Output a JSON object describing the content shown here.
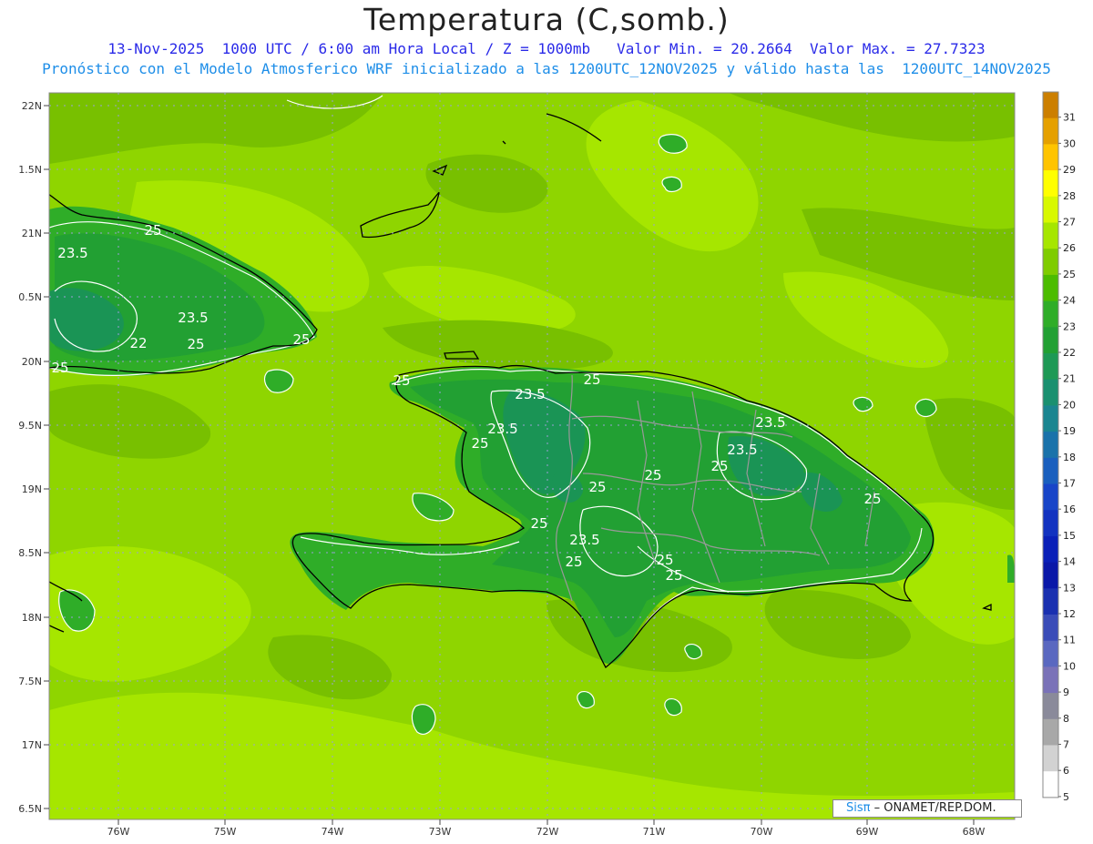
{
  "header": {
    "title": "Temperatura (C,somb.)",
    "line1": "13-Nov-2025  1000 UTC / 6:00 am Hora Local / Z = 1000mb   Valor Min. = 20.2664  Valor Max. = 27.7323",
    "line2": "Pronóstico con el Modelo Atmosferico WRF inicializado a las 1200UTC_12NOV2025 y válido hasta las  1200UTC_14NOV2025"
  },
  "map": {
    "lat_labels": [
      "22N",
      "1.5N",
      "21N",
      "0.5N",
      "20N",
      "9.5N",
      "19N",
      "8.5N",
      "18N",
      "7.5N",
      "17N",
      "6.5N"
    ],
    "lon_labels": [
      "76W",
      "75W",
      "74W",
      "73W",
      "72W",
      "71W",
      "70W",
      "69W",
      "68W"
    ],
    "contour_labels": [
      "25",
      "23.5",
      "23.5",
      "22",
      "25",
      "25",
      "25",
      "25",
      "23.5",
      "25",
      "23.5",
      "25",
      "23.5",
      "23.5",
      "25",
      "25",
      "25",
      "25",
      "25",
      "23.5",
      "25",
      "25",
      "25"
    ],
    "colors": {
      "ocean_main": "#8fd500",
      "ocean_light": "#a6e600",
      "ocean_dark": "#78c000",
      "land_warm": "#2fad28",
      "land_mid": "#22a033",
      "land_cool": "#1a9455",
      "contour_line": "#ffffff",
      "coastline": "#000000",
      "border_line": "#999999"
    }
  },
  "colorbar": {
    "labels": [
      "31",
      "30",
      "29",
      "28",
      "27",
      "26",
      "25",
      "24",
      "23",
      "22",
      "21",
      "20",
      "19",
      "18",
      "17",
      "16",
      "15",
      "14",
      "13",
      "12",
      "11",
      "10",
      "9",
      "8",
      "7",
      "6",
      "5"
    ],
    "colors": [
      "#cc7f00",
      "#e5a000",
      "#ffc400",
      "#ffff00",
      "#d8f800",
      "#a6e600",
      "#7fcc00",
      "#4cbc00",
      "#2fad28",
      "#22a033",
      "#1e9955",
      "#1a9070",
      "#1a8590",
      "#1a72aa",
      "#1a5fbe",
      "#1845c8",
      "#1232c0",
      "#0a20b8",
      "#0a18a8",
      "#1a30b0",
      "#3a4cb8",
      "#5a68c0",
      "#7a72b8",
      "#8a8a9a",
      "#a8a8a8",
      "#d2d2d2",
      "#ffffff"
    ]
  },
  "credit": {
    "brand": "Sisπ",
    "text": " – ONAMET/REP.DOM."
  }
}
